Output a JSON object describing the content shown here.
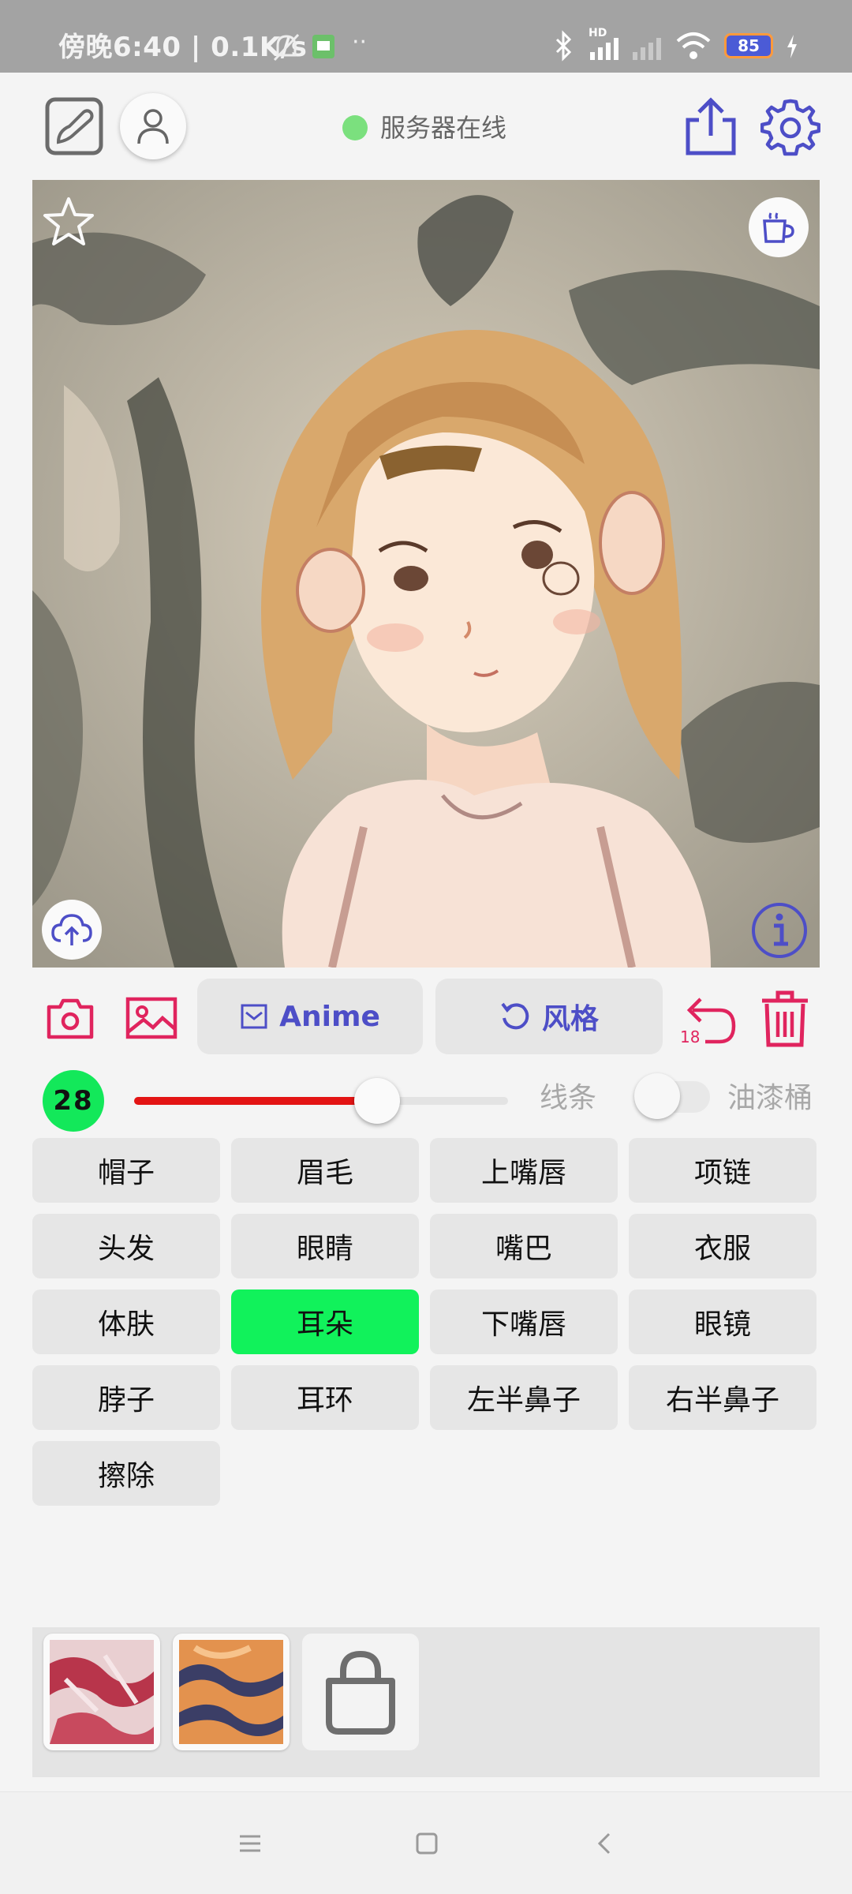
{
  "status_bar": {
    "time_text": "傍晚6:40 | 0.1K/s",
    "battery": "85",
    "network_label": "HD"
  },
  "header": {
    "server_status": "服务器在线",
    "server_status_color": "#7be07e"
  },
  "toolbar": {
    "mode_label": "Anime",
    "style_label": "风格",
    "undo_count": "18"
  },
  "brush": {
    "size": "28",
    "slider_fraction": 0.65,
    "line_label": "线条",
    "bucket_label": "油漆桶",
    "bucket_enabled": false
  },
  "parts": [
    {
      "label": "帽子",
      "active": false
    },
    {
      "label": "眉毛",
      "active": false
    },
    {
      "label": "上嘴唇",
      "active": false
    },
    {
      "label": "项链",
      "active": false
    },
    {
      "label": "头发",
      "active": false
    },
    {
      "label": "眼睛",
      "active": false
    },
    {
      "label": "嘴巴",
      "active": false
    },
    {
      "label": "衣服",
      "active": false
    },
    {
      "label": "体肤",
      "active": false
    },
    {
      "label": "耳朵",
      "active": true
    },
    {
      "label": "下嘴唇",
      "active": false
    },
    {
      "label": "眼镜",
      "active": false
    },
    {
      "label": "脖子",
      "active": false
    },
    {
      "label": "耳环",
      "active": false
    },
    {
      "label": "左半鼻子",
      "active": false
    },
    {
      "label": "右半鼻子",
      "active": false
    },
    {
      "label": "擦除",
      "active": false
    }
  ],
  "colors": {
    "accent": "#4d4ec7",
    "tool_red": "#e0245e",
    "active_part": "#11f25b",
    "slider_fill": "#e31414"
  },
  "icons": [
    "sketch-icon",
    "user-icon",
    "share-icon",
    "settings-icon",
    "star-icon",
    "coffee-icon",
    "cloud-upload-icon",
    "info-icon",
    "camera-icon",
    "image-icon",
    "mail-icon",
    "undo-icon",
    "trash-icon",
    "bag-icon"
  ]
}
